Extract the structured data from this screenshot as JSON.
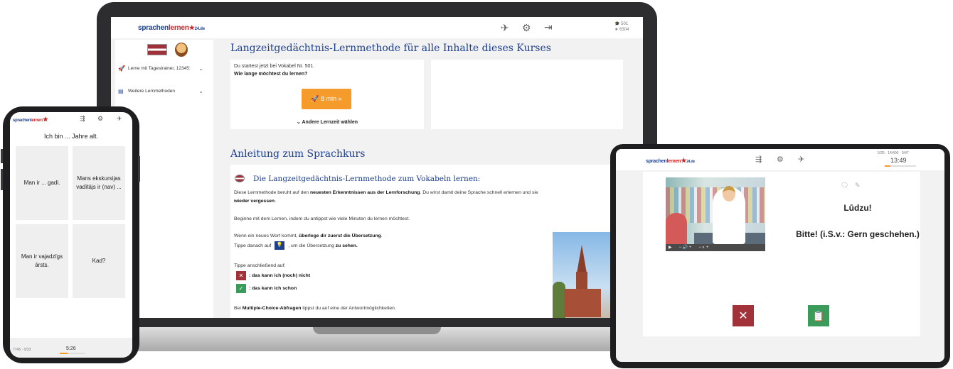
{
  "laptop": {
    "logo": {
      "main": "sprachen",
      "accent": "lernen",
      "suffix": "24.de"
    },
    "stats": {
      "line1": "501",
      "line2": "6304"
    },
    "icons": [
      "paper-plane-icon",
      "gear-icon",
      "logout-icon"
    ],
    "sidebar": {
      "items": [
        {
          "label": "Lerne mit Tagestrainer, 12345:",
          "icon": "rocket-icon"
        },
        {
          "label": "Weitere Lernmethoden",
          "icon": "book-icon"
        }
      ]
    },
    "section1": {
      "title": "Langzeitgedächtnis-Lernmethode für alle Inhalte dieses Kurses",
      "start_text": "Du startest jetzt bei Vokabel Nr. 501.",
      "question": "Wie lange möchtest du lernen?",
      "button": "8 min »",
      "other_time": "Andere Lernzeit wählen"
    },
    "section2": {
      "title": "Anleitung zum Sprachkurs",
      "subtitle": "Die Langzeitgedächtnis-Lernmethode zum Vokabeln lernen:",
      "p1a": "Diese Lernmethode beruht auf den ",
      "p1b": "neuesten Erkenntnissen aus der Lernforschung",
      "p1c": ". Du wirst damit deine Sprache schnell erlernen und sie",
      "p1d": "wieder vergessen",
      "p1e": ".",
      "p2": "Beginne mit dem Lernen, indem du antippst wie viele Minuten du lernen möchtest.",
      "p3a": "Wenn ein neues Wort kommt, ",
      "p3b": "überlege dir zuerst die Übersetzung",
      "p3c": ".",
      "p4a": "Tippe danach auf",
      "p4b": ", um die Übersetzung ",
      "p4c": "zu sehen.",
      "p5": "Tippe anschließend auf:",
      "no_label": ": das kann ich (noch) nicht",
      "yes_label": ": das kann ich schon",
      "p6a": "Bei ",
      "p6b": "Multiple-Choice-Abfragen",
      "p6c": " tippst du auf eine der Antwortmöglichkeiten."
    }
  },
  "phone": {
    "question": "Ich bin ... Jahre alt.",
    "answers": [
      "Man ir ... gadi.",
      "Mans ekskursijas vadītājs ir (nav) ...",
      "Man ir vajadzīgs ārsts.",
      "Kad?"
    ],
    "footer_stats": "7745 · 0/33",
    "time": "5:26"
  },
  "tablet": {
    "stats": "5/35 · 14/400 · 0/47",
    "time": "13:49",
    "greeting": "Lūdzu!",
    "answer": "Bitte! (i.S.v.: Gern geschehen.)"
  },
  "colors": {
    "brand_blue": "#1d3f8c",
    "accent_orange": "#f49b2c",
    "no_red": "#a2323a",
    "yes_green": "#3b9b5a"
  }
}
